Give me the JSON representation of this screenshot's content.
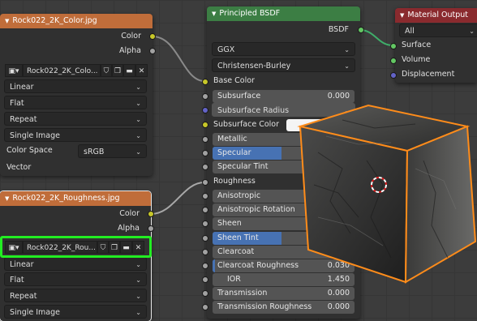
{
  "nodes": {
    "color_tex": {
      "title": "Rock022_2K_Color.jpg",
      "outputs": {
        "color": "Color",
        "alpha": "Alpha"
      },
      "image_name": "Rock022_2K_Colo...",
      "interpolation": "Linear",
      "projection": "Flat",
      "extension": "Repeat",
      "source": "Single Image",
      "color_space_label": "Color Space",
      "color_space_value": "sRGB",
      "vector_label": "Vector"
    },
    "rough_tex": {
      "title": "Rock022_2K_Roughness.jpg",
      "outputs": {
        "color": "Color",
        "alpha": "Alpha"
      },
      "image_name": "Rock022_2K_Rou...",
      "interpolation": "Linear",
      "projection": "Flat",
      "extension": "Repeat",
      "source": "Single Image"
    },
    "bsdf": {
      "title": "Principled BSDF",
      "output": "BSDF",
      "distribution": "GGX",
      "subsurface_method": "Christensen-Burley",
      "base_color": "Base Color",
      "subsurface": {
        "label": "Subsurface",
        "value": "0.000"
      },
      "subsurface_radius": "Subsurface Radius",
      "subsurface_color": "Subsurface Color",
      "metallic": "Metallic",
      "specular": "Specular",
      "specular_tint": "Specular Tint",
      "roughness": "Roughness",
      "anisotropic": "Anisotropic",
      "anisotropic_rotation": "Anisotropic Rotation",
      "sheen": "Sheen",
      "sheen_tint": "Sheen Tint",
      "clearcoat": "Clearcoat",
      "clearcoat_roughness": {
        "label": "Clearcoat Roughness",
        "value": "0.030"
      },
      "ior": {
        "label": "IOR",
        "value": "1.450"
      },
      "transmission": {
        "label": "Transmission",
        "value": "0.000"
      },
      "transmission_roughness": {
        "label": "Transmission Roughness",
        "value": "0.000"
      }
    },
    "material_output": {
      "title": "Material Output",
      "target": "All",
      "surface": "Surface",
      "volume": "Volume",
      "displacement": "Displacement"
    }
  },
  "colors": {
    "texture_header": "#c06d3a",
    "shader_header": "#3c7e44",
    "output_header": "#8a2a2e",
    "highlight": "#22ee22",
    "selection": "#ff8c1a",
    "slider_fill": "#4772b3"
  }
}
